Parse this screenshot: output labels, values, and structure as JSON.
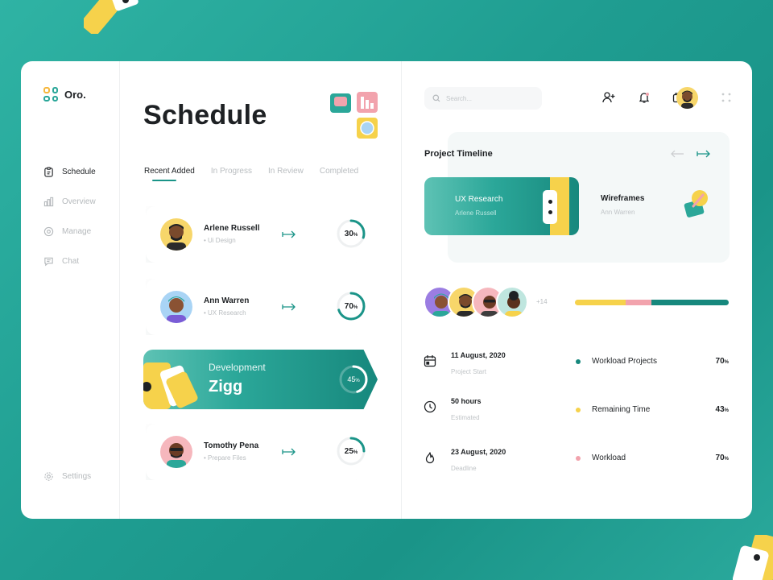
{
  "app": {
    "logo_text": "Oro."
  },
  "sidebar": {
    "items": [
      {
        "label": "Schedule",
        "icon": "clipboard-icon",
        "active": true
      },
      {
        "label": "Overview",
        "icon": "bar-chart-icon",
        "active": false
      },
      {
        "label": "Manage",
        "icon": "target-icon",
        "active": false
      },
      {
        "label": "Chat",
        "icon": "chat-icon",
        "active": false
      }
    ],
    "settings_label": "Settings"
  },
  "schedule": {
    "title": "Schedule",
    "tabs": [
      "Recent Added",
      "In Progress",
      "In Review",
      "Completed"
    ],
    "active_tab": "Recent Added",
    "cards": [
      {
        "name": "Arlene Russell",
        "role": "• Ui Design",
        "percent": 30,
        "percent_label": "30"
      },
      {
        "name": "Ann Warren",
        "role": "• UX Research",
        "percent": 70,
        "percent_label": "70"
      },
      {
        "name": "Tomothy Pena",
        "role": "• Prepare Files",
        "percent": 25,
        "percent_label": "25"
      }
    ],
    "featured": {
      "label": "Development",
      "name": "Zigg",
      "percent": 45,
      "percent_label": "45"
    },
    "percent_unit": "%"
  },
  "header": {
    "search_placeholder": "Search..."
  },
  "timeline": {
    "title": "Project Timeline",
    "items": [
      {
        "title": "UX Research",
        "subtitle": "Arlene Russell"
      },
      {
        "title": "Wireframes",
        "subtitle": "Ann Warren"
      }
    ]
  },
  "team": {
    "more_label": "+14",
    "progress_segments": [
      {
        "color": "#f6d24b",
        "fraction": 0.33
      },
      {
        "color": "#f2a3ad",
        "fraction": 0.17
      },
      {
        "color": "#17887d",
        "fraction": 0.5
      }
    ]
  },
  "details": [
    {
      "value": "11 August, 2020",
      "label": "Project Start",
      "icon": "calendar-icon"
    },
    {
      "value": "50 hours",
      "label": "Estimated",
      "icon": "clock-icon"
    },
    {
      "value": "23 August, 2020",
      "label": "Deadline",
      "icon": "flame-icon"
    }
  ],
  "stats": [
    {
      "label": "Workload Projects",
      "value": "70",
      "color": "#17887d"
    },
    {
      "label": "Remaining Time",
      "value": "43",
      "color": "#f6d24b"
    },
    {
      "label": "Workload",
      "value": "70",
      "color": "#f2a3ad"
    }
  ],
  "colors": {
    "accent": "#1a9488",
    "yellow": "#f6d24b",
    "pink": "#f2a3ad"
  }
}
